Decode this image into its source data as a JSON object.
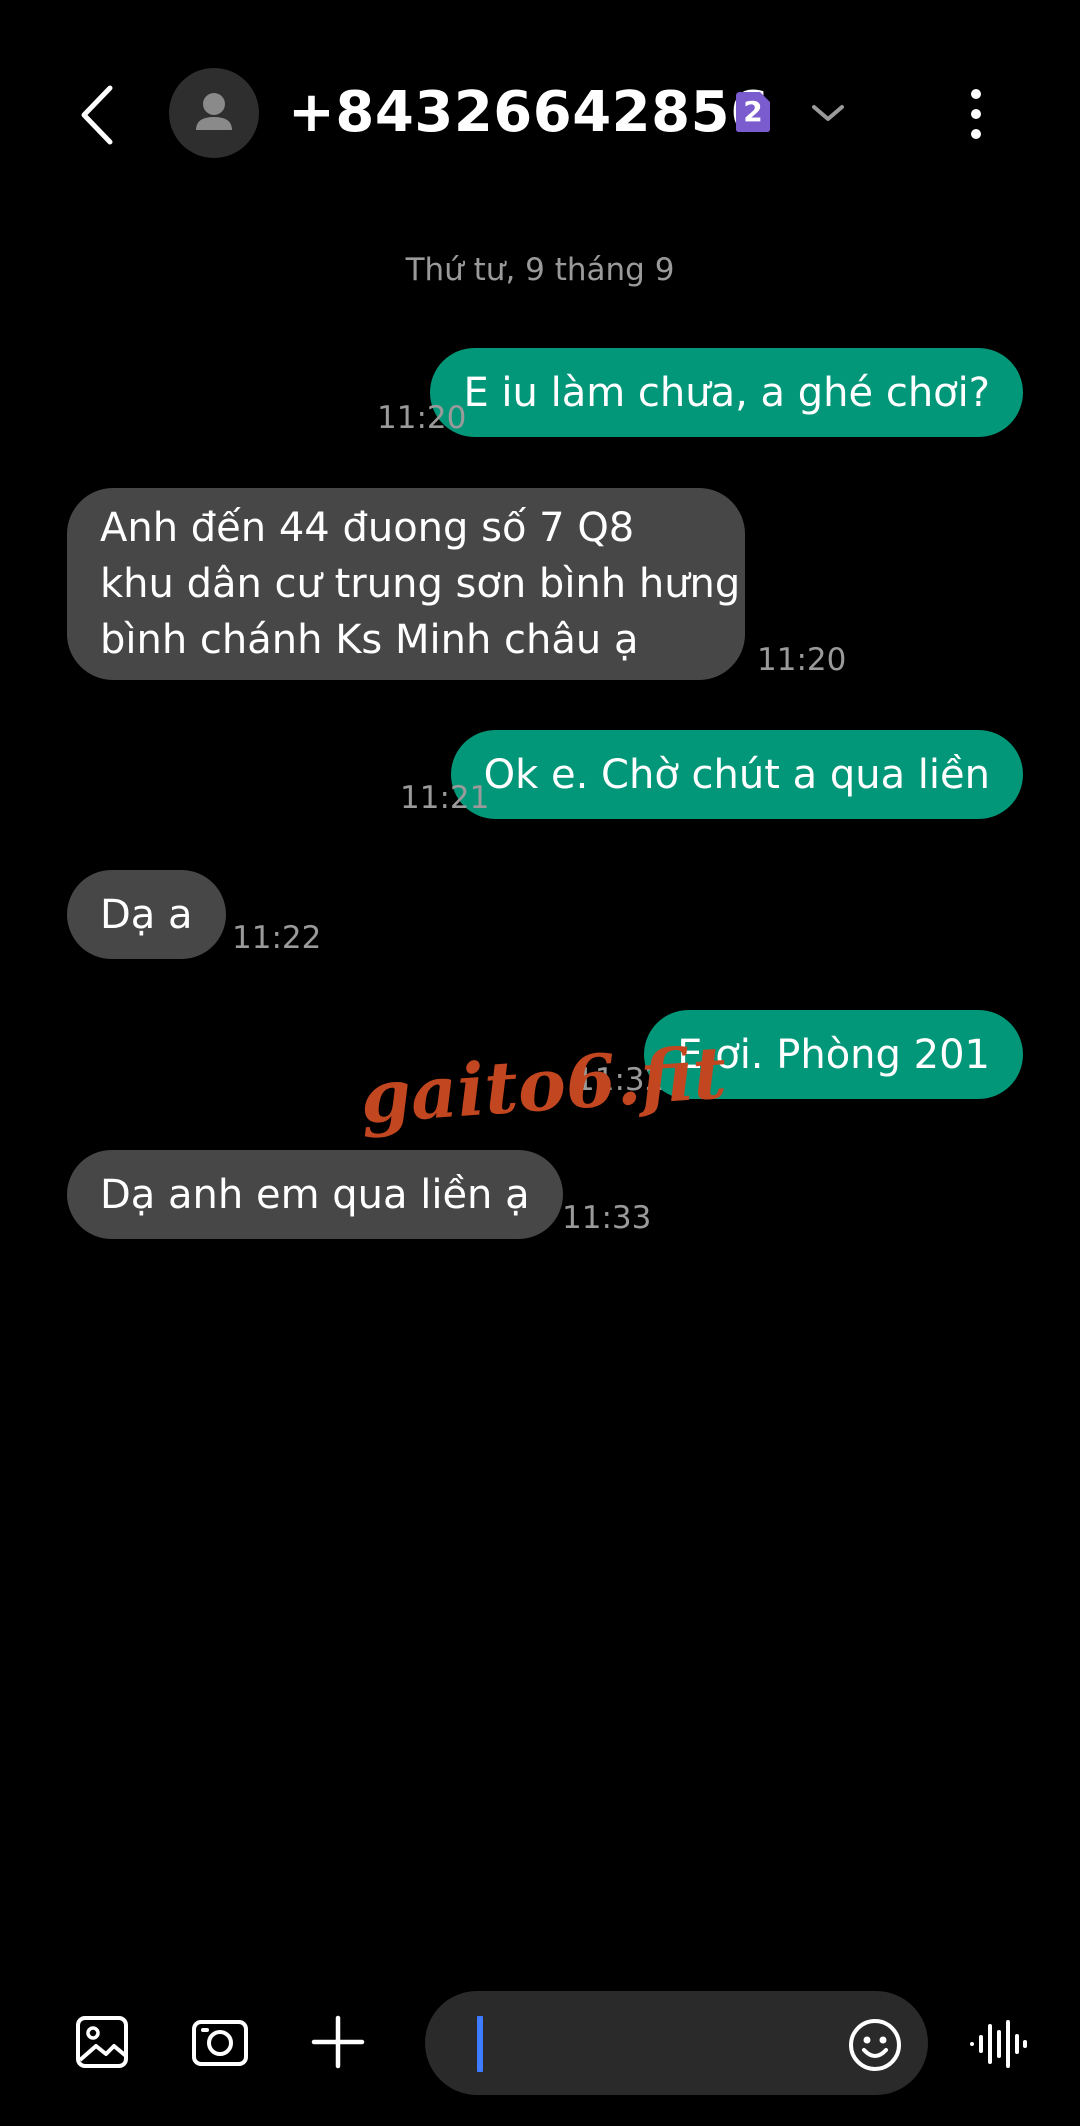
{
  "header": {
    "contact": "+84326642856",
    "sim_label": "2",
    "back_icon": "back-arrow-icon",
    "avatar_icon": "person-icon",
    "dropdown_icon": "chevron-down-icon",
    "menu_icon": "more-vertical-icon"
  },
  "date_separator": "Thứ tư, 9 tháng 9",
  "messages": [
    {
      "direction": "outgoing",
      "text": "E iu làm chưa, a ghé chơi?",
      "time": "11:20"
    },
    {
      "direction": "incoming",
      "lines": [
        "Anh đến 44 đuong số 7   Q8",
        "khu dân cư trung sơn  bình hưng",
        "bình chánh   Ks Minh châu ạ"
      ],
      "time": "11:20"
    },
    {
      "direction": "outgoing",
      "text": "Ok e. Chờ chút a qua liền",
      "time": "11:21"
    },
    {
      "direction": "incoming",
      "text": "Dạ a",
      "time": "11:22"
    },
    {
      "direction": "outgoing",
      "text": "E ơi. Phòng 201",
      "time": "11:32"
    },
    {
      "direction": "incoming",
      "text": "Dạ  anh  em qua liền ạ",
      "time": "11:33"
    }
  ],
  "watermark": "gaito6.fit",
  "composer": {
    "placeholder": "",
    "value": ""
  },
  "toolbar_icons": [
    "gallery-icon",
    "camera-icon",
    "plus-icon",
    "emoji-icon",
    "voice-icon"
  ],
  "colors": {
    "background": "#000000",
    "outgoing_bubble": "#039779",
    "incoming_bubble": "#474747",
    "timestamp": "#9a9a9a",
    "sim_badge": "#7b5ccf",
    "caret": "#3e7cff",
    "watermark": "#c2461f"
  }
}
